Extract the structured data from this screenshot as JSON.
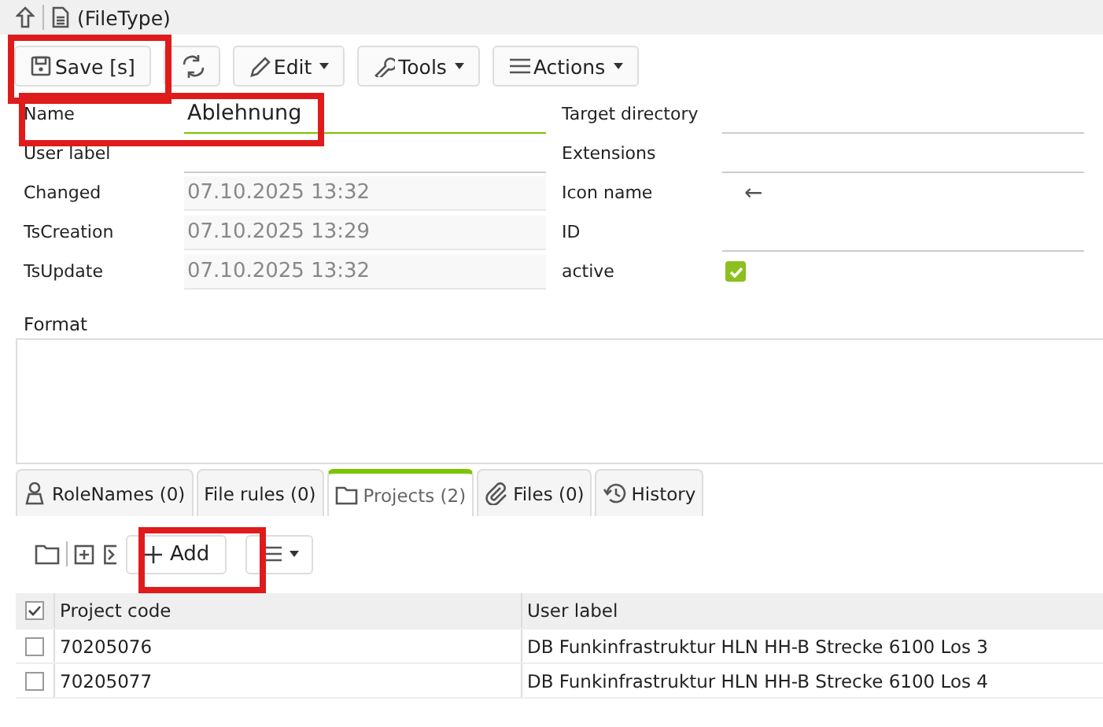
{
  "header": {
    "title": "(FileType)"
  },
  "toolbar": [
    {
      "kind": "save",
      "label": "Save [s]"
    },
    {
      "kind": "refresh"
    },
    {
      "kind": "edit",
      "label": "Edit"
    },
    {
      "kind": "tools",
      "label": "Tools"
    },
    {
      "kind": "actions",
      "label": "Actions"
    }
  ],
  "left_fields": [
    {
      "label": "Name",
      "kind": "input",
      "value": "Ablehnung",
      "focused": true
    },
    {
      "label": "User label",
      "kind": "input",
      "focused": false
    },
    {
      "label": "Changed",
      "kind": "readonly",
      "value": "07.10.2025 13:32"
    },
    {
      "label": "TsCreation",
      "kind": "readonly",
      "value": "07.10.2025 13:29"
    },
    {
      "label": "TsUpdate",
      "kind": "readonly",
      "value": "07.10.2025 13:32"
    }
  ],
  "right_fields": [
    {
      "label": "Target directory",
      "kind": "input"
    },
    {
      "label": "Extensions",
      "kind": "input"
    },
    {
      "label": "Icon name",
      "kind": "plain",
      "value": "←"
    },
    {
      "label": "ID",
      "kind": "input"
    },
    {
      "label": "active",
      "kind": "checkbox",
      "checked": true
    }
  ],
  "format": {
    "label": "Format"
  },
  "tabs": [
    {
      "kind": "roles",
      "label": "RoleNames (0)",
      "selected": false
    },
    {
      "kind": "none",
      "label": "File rules (0)",
      "selected": false
    },
    {
      "kind": "folder",
      "label": "Projects (2)",
      "selected": true
    },
    {
      "kind": "clip",
      "label": "Files (0)",
      "selected": false
    },
    {
      "kind": "history",
      "label": "History",
      "selected": false
    }
  ],
  "subtoolbar": {
    "add_label": "Add"
  },
  "table": {
    "columns": [
      "Project code",
      "User label"
    ],
    "all_checked": true,
    "rows": [
      {
        "checked": false,
        "cells": [
          "70205076",
          "DB Funkinfrastruktur HLN HH-B Strecke 6100 Los 3"
        ]
      },
      {
        "checked": false,
        "cells": [
          "70205077",
          "DB Funkinfrastruktur HLN HH-B Strecke 6100 Los 4"
        ]
      }
    ]
  }
}
